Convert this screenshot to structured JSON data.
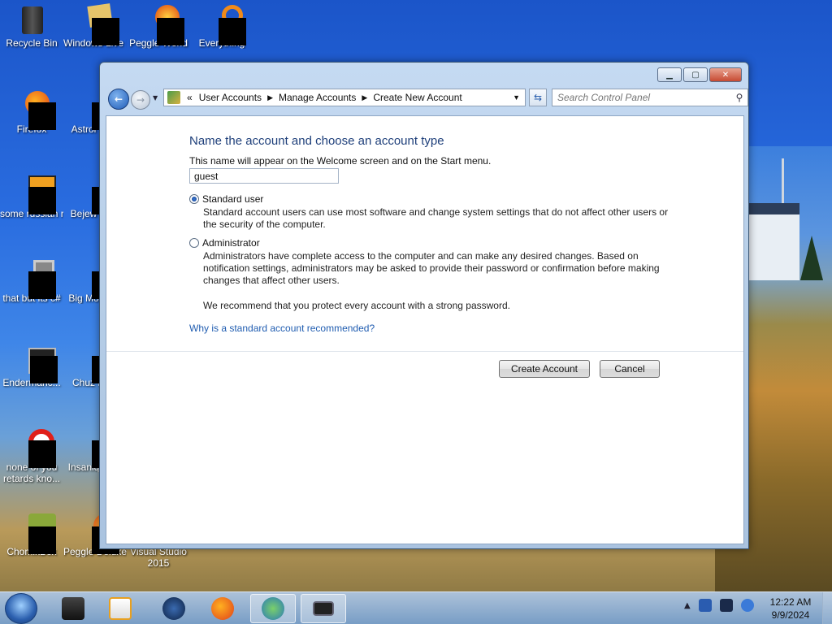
{
  "desktop": {
    "icons": [
      {
        "label": "Recycle Bin",
        "icon": "recycle-bin-icon"
      },
      {
        "label": "Windows Live Ma",
        "icon": "windows-live-mail-icon"
      },
      {
        "label": "Peggle World",
        "icon": "peggle-world-icon"
      },
      {
        "label": "Everything",
        "icon": "everything-search-icon"
      },
      {
        "label": "Firefox",
        "icon": "firefox-icon"
      },
      {
        "label": "Astrol Delu",
        "icon": "astro-deluxe-icon"
      },
      {
        "label": "some russian ran a rat",
        "icon": "app-icon"
      },
      {
        "label": "Bejew Delu",
        "icon": "bejeweled-icon"
      },
      {
        "label": "that but its c#",
        "icon": "app-icon"
      },
      {
        "label": "Big Mo Delu",
        "icon": "game-icon"
      },
      {
        "label": "Endermanc...",
        "icon": "app-icon"
      },
      {
        "label": "Chuz Delu",
        "icon": "game-icon"
      },
      {
        "label": "none of you retards kno...",
        "icon": "opera-icon"
      },
      {
        "label": "Insaniq Delu",
        "icon": "game-icon"
      },
      {
        "label": "ChomikBox",
        "icon": "chomikbox-icon"
      },
      {
        "label": "Peggle Deluxe",
        "icon": "peggle-deluxe-icon"
      },
      {
        "label": "Visual Studio 2015",
        "icon": "visual-studio-icon"
      }
    ]
  },
  "window": {
    "controls": {
      "minimize": "minimize-icon",
      "maximize": "maximize-icon",
      "close": "close-icon"
    },
    "breadcrumb": {
      "overflow": "«",
      "items": [
        "User Accounts",
        "Manage Accounts",
        "Create New Account"
      ]
    },
    "search": {
      "placeholder": "Search Control Panel"
    },
    "content": {
      "heading": "Name the account and choose an account type",
      "description": "This name will appear on the Welcome screen and on the Start menu.",
      "account_name": "guest",
      "options": [
        {
          "label": "Standard user",
          "checked": true,
          "description": "Standard account users can use most software and change system settings that do not affect other users or the security of the computer."
        },
        {
          "label": "Administrator",
          "checked": false,
          "description": "Administrators have complete access to the computer and can make any desired changes. Based on notification settings, administrators may be asked to provide their password or confirmation before making changes that affect other users."
        }
      ],
      "recommendation": "We recommend that you protect every account with a strong password.",
      "help_link": "Why is a standard account recommended?",
      "buttons": {
        "create": "Create Account",
        "cancel": "Cancel"
      }
    }
  },
  "taskbar": {
    "pinned": [
      "start-orb",
      "app-icon",
      "media-player-icon",
      "browser-icon",
      "firefox-icon",
      "internet-download-manager-icon",
      "control-panel-icon"
    ],
    "tray": [
      "show-hidden-icons",
      "network-icon",
      "display-icon",
      "volume-icon"
    ],
    "clock": {
      "time": "12:22 AM",
      "date": "9/9/2024"
    }
  }
}
